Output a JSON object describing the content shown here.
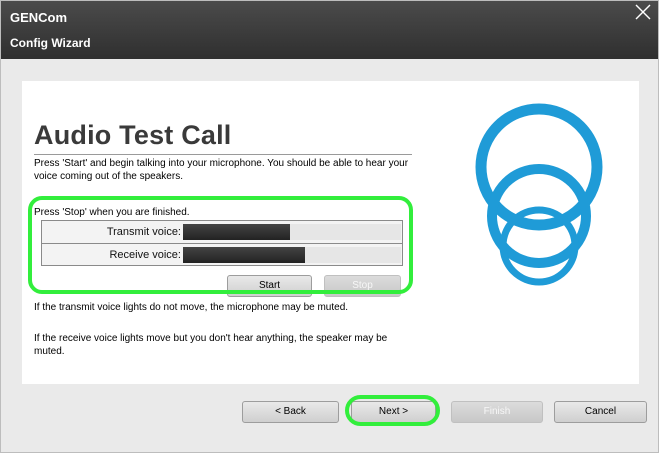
{
  "window": {
    "app_title": "GENCom",
    "subtitle": "Config Wizard",
    "close_icon": "close-icon"
  },
  "page": {
    "heading": "Audio Test Call",
    "instructions": "Press 'Start' and begin talking into your microphone. You should be able to hear your voice coming out of the speakers.",
    "stop_hint": "Press 'Stop' when you are finished.",
    "mute_mic_hint": "If the transmit voice lights do not move, the microphone may be muted.",
    "mute_speaker_hint": "If the receive voice lights move but you don't hear anything, the speaker may be muted."
  },
  "meters": {
    "transmit_label": "Transmit voice:",
    "transmit_level": 0.49,
    "receive_label": "Receive voice:",
    "receive_level": 0.56
  },
  "controls": {
    "start_label": "Start",
    "stop_label": "Stop",
    "stop_enabled": false
  },
  "nav": {
    "back_label": "< Back",
    "next_label": "Next >",
    "finish_label": "Finish",
    "finish_enabled": false,
    "cancel_label": "Cancel"
  },
  "colors": {
    "titlebar": "#3a3a3a",
    "logo_blue": "#1f9bd7",
    "highlight_green": "#32ee3c",
    "meter_fill": "#2a2a2a"
  },
  "logo": {
    "icon": "concentric-rings-logo-icon"
  }
}
